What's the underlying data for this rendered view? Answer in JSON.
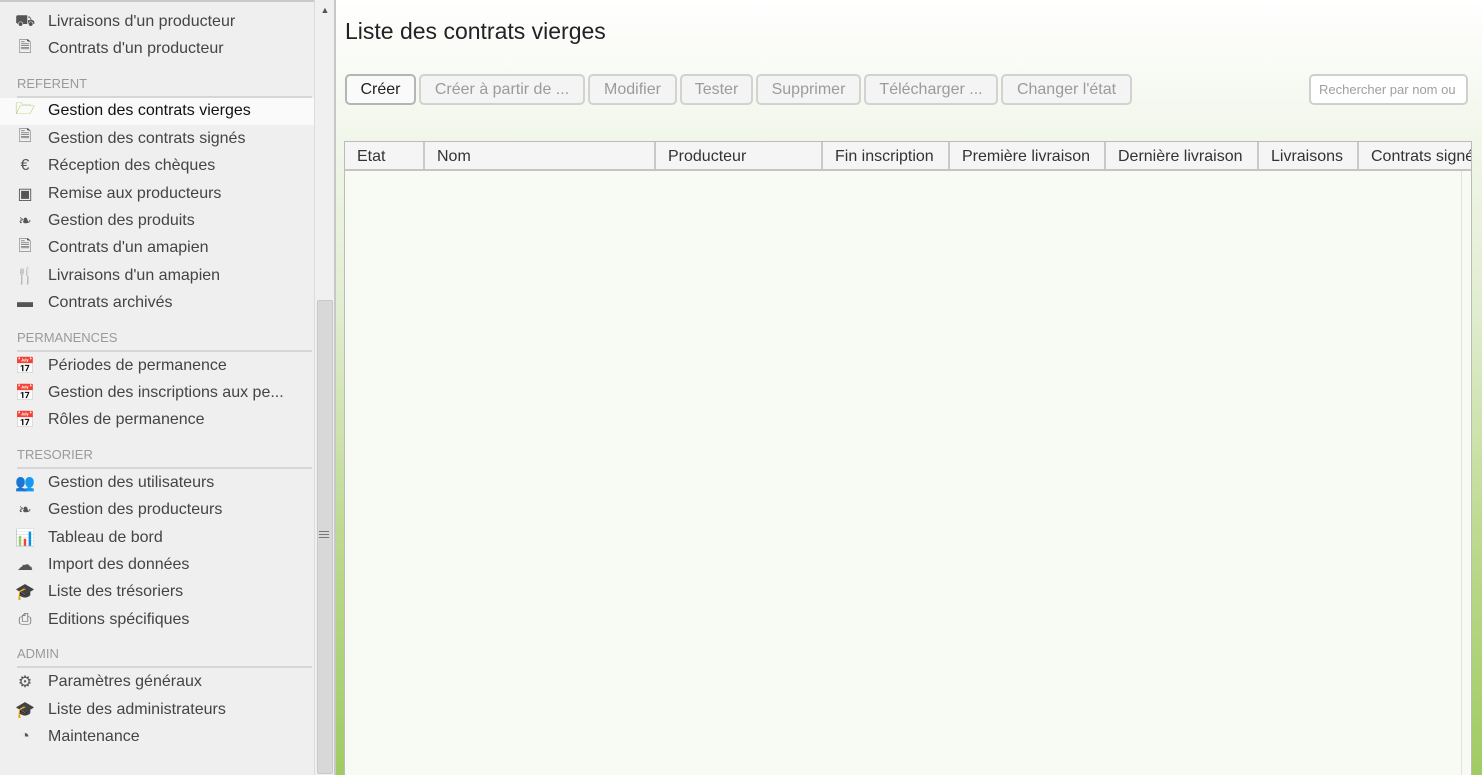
{
  "sidebar": {
    "top_items": [
      {
        "label": "Livraisons d'un producteur",
        "icon": "truck-icon",
        "glyph": "⛟"
      },
      {
        "label": "Contrats d'un producteur",
        "icon": "document-icon",
        "glyph": "🗎"
      }
    ],
    "sections": [
      {
        "title": "REFERENT",
        "items": [
          {
            "label": "Gestion des contrats vierges",
            "icon": "folder-open-icon",
            "glyph": "🗁",
            "active": true
          },
          {
            "label": "Gestion des contrats signés",
            "icon": "document-icon",
            "glyph": "🗎"
          },
          {
            "label": "Réception des chèques",
            "icon": "euro-icon",
            "glyph": "€"
          },
          {
            "label": "Remise aux producteurs",
            "icon": "money-icon",
            "glyph": "▣"
          },
          {
            "label": "Gestion des produits",
            "icon": "leaf-icon",
            "glyph": "❧"
          },
          {
            "label": "Contrats d'un amapien",
            "icon": "document-icon",
            "glyph": "🗎"
          },
          {
            "label": "Livraisons d'un amapien",
            "icon": "cutlery-icon",
            "glyph": "🍴"
          },
          {
            "label": "Contrats archivés",
            "icon": "archive-icon",
            "glyph": "▬"
          }
        ]
      },
      {
        "title": "PERMANENCES",
        "items": [
          {
            "label": "Périodes de permanence",
            "icon": "calendar-icon",
            "glyph": "📅"
          },
          {
            "label": "Gestion des inscriptions aux pe...",
            "icon": "calendar-icon",
            "glyph": "📅"
          },
          {
            "label": "Rôles de permanence",
            "icon": "calendar-icon",
            "glyph": "📅"
          }
        ]
      },
      {
        "title": "TRESORIER",
        "items": [
          {
            "label": "Gestion des utilisateurs",
            "icon": "users-icon",
            "glyph": "👥"
          },
          {
            "label": "Gestion des producteurs",
            "icon": "leaf-icon",
            "glyph": "❧"
          },
          {
            "label": "Tableau de bord",
            "icon": "bar-chart-icon",
            "glyph": "📊"
          },
          {
            "label": "Import des données",
            "icon": "cloud-download-icon",
            "glyph": "☁"
          },
          {
            "label": "Liste des trésoriers",
            "icon": "graduation-cap-icon",
            "glyph": "🎓"
          },
          {
            "label": "Editions spécifiques",
            "icon": "print-icon",
            "glyph": "⎙"
          }
        ]
      },
      {
        "title": "ADMIN",
        "items": [
          {
            "label": "Paramètres généraux",
            "icon": "gear-icon",
            "glyph": "⚙"
          },
          {
            "label": "Liste des administrateurs",
            "icon": "graduation-cap-icon",
            "glyph": "🎓"
          },
          {
            "label": "Maintenance",
            "icon": "dashboard-icon",
            "glyph": "◔"
          }
        ]
      }
    ]
  },
  "main": {
    "title": "Liste des contrats vierges",
    "toolbar": {
      "create": "Créer",
      "create_from": "Créer à partir de ...",
      "modify": "Modifier",
      "test": "Tester",
      "delete": "Supprimer",
      "download": "Télécharger ...",
      "change_state": "Changer l'état"
    },
    "search": {
      "placeholder": "Rechercher par nom ou producteur"
    },
    "table": {
      "columns": [
        "Etat",
        "Nom",
        "Producteur",
        "Fin inscription",
        "Première livraison",
        "Dernière livraison",
        "Livraisons",
        "Contrats signés"
      ],
      "rows": []
    }
  },
  "colors": {
    "active_icon": "#8bbd3c",
    "accent_green": "#a0cc63"
  }
}
